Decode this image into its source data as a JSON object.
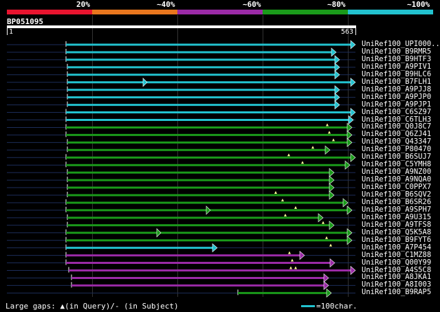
{
  "identity_legend": {
    "labels": [
      "20%",
      "~40%",
      "~60%",
      "~80%",
      "~100%"
    ],
    "colors": [
      "#e8142f",
      "#e8761e",
      "#9a2aa6",
      "#1a9a1a",
      "#22c2cf"
    ]
  },
  "query": {
    "id": "BP051095",
    "start": "1",
    "end": "563"
  },
  "hits": [
    {
      "label": "UniRef100_UPI000..",
      "color": "#22c2cf",
      "start": 96,
      "end": 517,
      "marks": []
    },
    {
      "label": "UniRef100_B9RMR5",
      "color": "#22c2cf",
      "start": 96,
      "end": 489,
      "marks": []
    },
    {
      "label": "UniRef100_B9HTF3",
      "color": "#22c2cf",
      "start": 96,
      "end": 494,
      "marks": []
    },
    {
      "label": "UniRef100_A9PIV1",
      "color": "#22c2cf",
      "start": 98,
      "end": 494,
      "marks": []
    },
    {
      "label": "UniRef100_B9HLC6",
      "color": "#22c2cf",
      "start": 98,
      "end": 494,
      "marks": []
    },
    {
      "label": "UniRef100_B7FLH1",
      "color": "#22c2cf",
      "start": 98,
      "end": 517,
      "marks": [
        {
          "type": "arrow",
          "at": 214
        }
      ]
    },
    {
      "label": "UniRef100_A9PJJ8",
      "color": "#22c2cf",
      "start": 98,
      "end": 494,
      "marks": []
    },
    {
      "label": "UniRef100_A9PJP0",
      "color": "#22c2cf",
      "start": 98,
      "end": 494,
      "marks": []
    },
    {
      "label": "UniRef100_A9PJP1",
      "color": "#22c2cf",
      "start": 98,
      "end": 494,
      "marks": []
    },
    {
      "label": "UniRef100_C6SZ97",
      "color": "#22c2cf",
      "start": 96,
      "end": 517,
      "marks": []
    },
    {
      "label": "UniRef100_C6TLH3",
      "color": "#22c2cf",
      "start": 96,
      "end": 514,
      "marks": []
    },
    {
      "label": "UniRef100_Q0J8C7",
      "color": "#1a9a1a",
      "start": 96,
      "end": 512,
      "marks": [
        {
          "type": "tri",
          "at": 476
        }
      ]
    },
    {
      "label": "UniRef100_Q6ZJ41",
      "color": "#1a9a1a",
      "start": 96,
      "end": 512,
      "marks": [
        {
          "type": "tri",
          "at": 479
        }
      ]
    },
    {
      "label": "UniRef100_Q43347",
      "color": "#1a9a1a",
      "start": 98,
      "end": 512,
      "marks": [
        {
          "type": "tri",
          "at": 485
        }
      ]
    },
    {
      "label": "UniRef100_P80470",
      "color": "#1a9a1a",
      "start": 98,
      "end": 480,
      "marks": [
        {
          "type": "tri",
          "at": 455
        }
      ]
    },
    {
      "label": "UniRef100_B6SUJ7",
      "color": "#1a9a1a",
      "start": 96,
      "end": 517,
      "marks": [
        {
          "type": "tri",
          "at": 420
        }
      ]
    },
    {
      "label": "UniRef100_C5YMH8",
      "color": "#1a9a1a",
      "start": 96,
      "end": 509,
      "marks": [
        {
          "type": "tri",
          "at": 440
        }
      ]
    },
    {
      "label": "UniRef100_A9NZ00",
      "color": "#1a9a1a",
      "start": 98,
      "end": 486,
      "marks": []
    },
    {
      "label": "UniRef100_A9NQA0",
      "color": "#1a9a1a",
      "start": 98,
      "end": 486,
      "marks": []
    },
    {
      "label": "UniRef100_C0PPX7",
      "color": "#1a9a1a",
      "start": 98,
      "end": 486,
      "marks": []
    },
    {
      "label": "UniRef100_B6SQV2",
      "color": "#1a9a1a",
      "start": 98,
      "end": 486,
      "marks": [
        {
          "type": "tri",
          "at": 401
        }
      ]
    },
    {
      "label": "UniRef100_B6SR26",
      "color": "#1a9a1a",
      "start": 96,
      "end": 506,
      "marks": [
        {
          "type": "tri",
          "at": 411
        }
      ]
    },
    {
      "label": "UniRef100_A9SPH7",
      "color": "#1a9a1a",
      "start": 96,
      "end": 512,
      "marks": [
        {
          "type": "arrow",
          "at": 306
        },
        {
          "type": "tri",
          "at": 430
        }
      ]
    },
    {
      "label": "UniRef100_A9U315",
      "color": "#1a9a1a",
      "start": 98,
      "end": 470,
      "marks": [
        {
          "type": "tri",
          "at": 415
        }
      ]
    },
    {
      "label": "UniRef100_A9TFS8",
      "color": "#1a9a1a",
      "start": 98,
      "end": 486,
      "marks": [
        {
          "type": "tri",
          "at": 470
        }
      ]
    },
    {
      "label": "UniRef100_Q5K5A8",
      "color": "#1a9a1a",
      "start": 96,
      "end": 512,
      "marks": [
        {
          "type": "arrow",
          "at": 234
        }
      ]
    },
    {
      "label": "UniRef100_B9FYT6",
      "color": "#1a9a1a",
      "start": 96,
      "end": 512,
      "marks": [
        {
          "type": "tri",
          "at": 475
        }
      ]
    },
    {
      "label": "UniRef100_A7P454",
      "color": "#22c2cf",
      "start": 96,
      "end": 316,
      "marks": [
        {
          "type": "tri",
          "at": 481
        }
      ]
    },
    {
      "label": "UniRef100_C1MZ88",
      "color": "#9a2aa6",
      "start": 96,
      "end": 443,
      "marks": [
        {
          "type": "tri",
          "at": 421
        }
      ]
    },
    {
      "label": "UniRef100_Q00Y99",
      "color": "#9a2aa6",
      "start": 96,
      "end": 487,
      "marks": [
        {
          "type": "tri",
          "at": 425
        }
      ]
    },
    {
      "label": "UniRef100_A4S5C8",
      "color": "#9a2aa6",
      "start": 100,
      "end": 517,
      "marks": [
        {
          "type": "tri",
          "at": 423
        },
        {
          "type": "tri",
          "at": 430
        }
      ]
    },
    {
      "label": "UniRef100_A8JKA1",
      "color": "#9a2aa6",
      "start": 104,
      "end": 478,
      "marks": []
    },
    {
      "label": "UniRef100_A8I003",
      "color": "#9a2aa6",
      "start": 104,
      "end": 478,
      "marks": []
    },
    {
      "label": "UniRef100_B9RAP5",
      "color": "#1a9a1a",
      "start": 346,
      "end": 482,
      "marks": []
    }
  ],
  "legend": {
    "gaps_text": "Large gaps: ▲(in Query)/- (in Subject)",
    "scale_text": "=100char.",
    "scale_color": "#22c2cf"
  }
}
